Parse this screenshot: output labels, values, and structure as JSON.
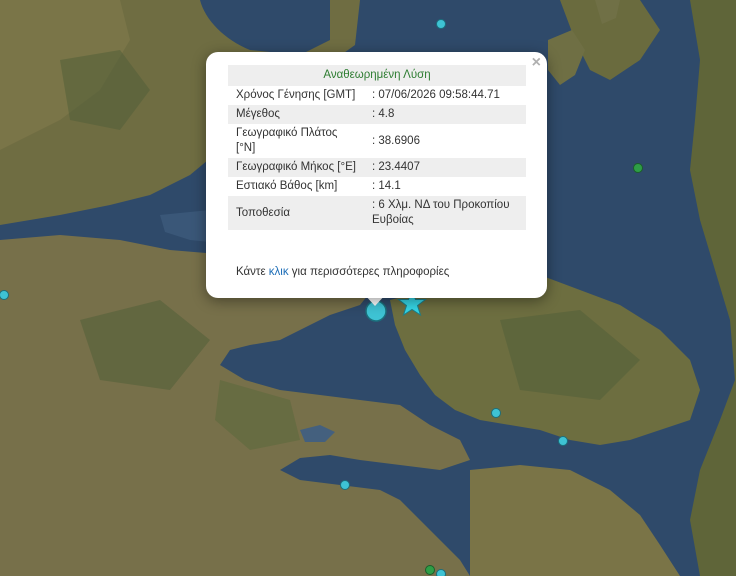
{
  "popup": {
    "header": "Αναθεωρημένη Λύση",
    "close_label": "×",
    "rows": [
      {
        "label": "Χρόνος Γένησης [GMT]",
        "value": ": 07/06/2026 09:58:44.71"
      },
      {
        "label": "Μέγεθος",
        "value": ": 4.8"
      },
      {
        "label": "Γεωγραφικό Πλάτος [°N]",
        "value": ": 38.6906"
      },
      {
        "label": "Γεωγραφικό Μήκος [°E]",
        "value": ": 23.4407"
      },
      {
        "label": "Εστιακό Βάθος [km]",
        "value": ": 14.1"
      },
      {
        "label": "Τοποθεσία",
        "value": ": 6 Χλμ. ΝΔ του Προκοπίου Ευβοίας"
      }
    ],
    "more_prefix": "Κάντε ",
    "more_link": "κλικ",
    "more_suffix": " για περισσότερες πληροφορίες"
  },
  "colors": {
    "sea": "#2f4a6a",
    "land": "#6b6a3e",
    "marker_cyan": "#3ec3d4",
    "marker_green": "#2e9e46",
    "highlight_star": "#35d6e6",
    "header_text": "#2e7d32",
    "link": "#1f6fb8"
  },
  "markers": [
    {
      "type": "event-circle",
      "color": "cyan"
    },
    {
      "type": "event-circle",
      "color": "cyan"
    },
    {
      "type": "event-circle",
      "color": "cyan"
    },
    {
      "type": "event-circle",
      "color": "cyan"
    },
    {
      "type": "event-circle",
      "color": "cyan"
    },
    {
      "type": "event-circle",
      "color": "cyan"
    },
    {
      "type": "event-circle",
      "color": "green"
    },
    {
      "type": "event-circle",
      "color": "green"
    },
    {
      "type": "selected-event-circle",
      "color": "cyan"
    },
    {
      "type": "epicenter-star",
      "color": "cyan"
    }
  ]
}
